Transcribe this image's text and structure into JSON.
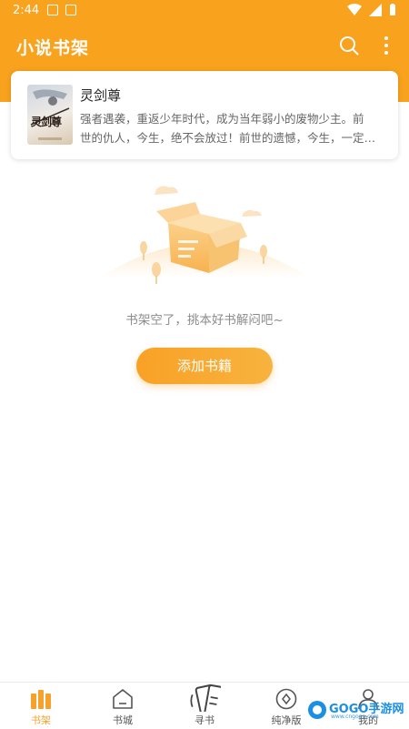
{
  "status_bar": {
    "time": "2:44"
  },
  "header": {
    "title": "小说书架"
  },
  "book": {
    "title": "灵剑尊",
    "description_line1": "强者遇袭，重返少年时代，成为当年弱小的废物少主。前",
    "description_line2": "世的仇人，今生，绝不会放过！前世的遗憾，今生，一定…",
    "cover_text": "灵剑尊"
  },
  "empty_state": {
    "message": "书架空了，挑本好书解闷吧~"
  },
  "add_button": {
    "label": "添加书籍"
  },
  "tabs": [
    {
      "label": "书架",
      "icon": "bookshelf-icon",
      "active": true
    },
    {
      "label": "书城",
      "icon": "bookstore-icon",
      "active": false
    },
    {
      "label": "寻书",
      "icon": "find-book-icon",
      "active": false
    },
    {
      "label": "纯净版",
      "icon": "pure-version-icon",
      "active": false
    },
    {
      "label": "我的",
      "icon": "profile-icon",
      "active": false
    }
  ],
  "watermark": {
    "brand": "GOGO手游网",
    "url": "www.cngogo.com"
  },
  "colors": {
    "accent": "#f8a21d",
    "tab_active": "#f6a22a"
  }
}
